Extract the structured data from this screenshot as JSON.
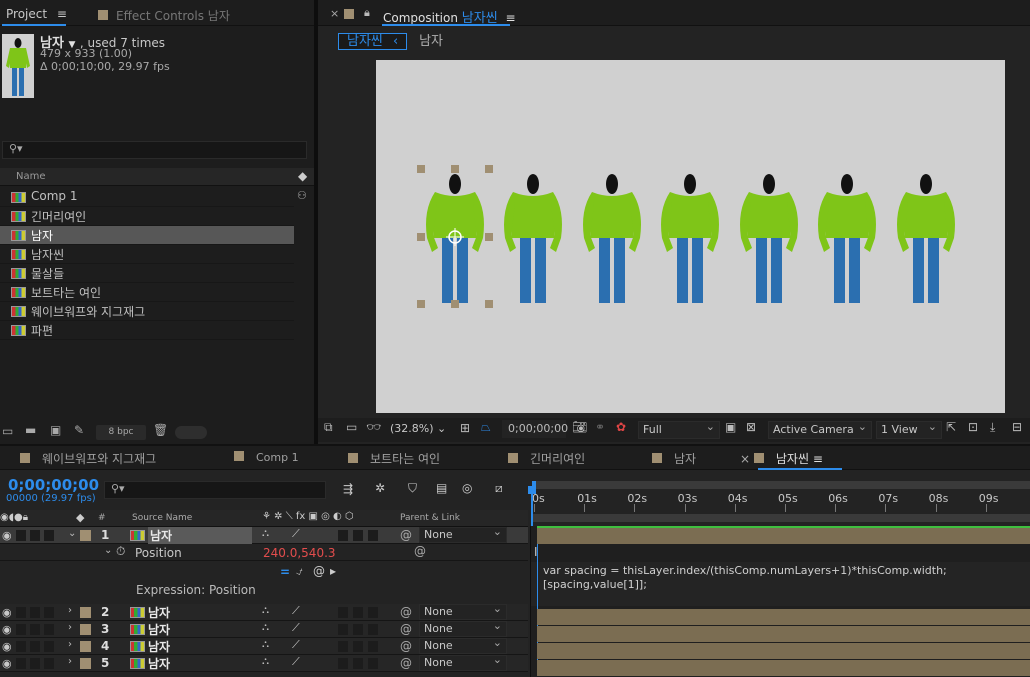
{
  "project_panel": {
    "tab_label": "Project",
    "effect_controls_label": "Effect Controls 남자",
    "footage_name": "남자",
    "used_text": ", used 7 times",
    "dimensions_text": "479 x 933 (1.00)",
    "duration_text": "Δ 0;00;10;00, 29.97 fps",
    "column_name": "Name",
    "items": [
      "Comp 1",
      "긴머리여인",
      "남자",
      "남자씬",
      "물살들",
      "보트타는 여인",
      "웨이브워프와 지그재그",
      "파편"
    ],
    "selected_index": 2,
    "bpc_label": "8 bpc"
  },
  "composition_panel": {
    "title_prefix": "Composition",
    "title_name": "남자씬",
    "breadcrumb_active": "남자씬",
    "breadcrumb_other": "남자",
    "zoom": "(32.8%)",
    "timecode": "0;00;00;00",
    "resolution": "Full",
    "camera": "Active Camera",
    "views": "1 View",
    "figure_count": 7,
    "bg_color": "#d0d0d0",
    "shirt_color": "#7fc518",
    "pants_color": "#2b6fb0",
    "head_color": "#111111"
  },
  "timeline": {
    "tabs": [
      "웨이브워프와 지그재그",
      "Comp 1",
      "보트타는 여인",
      "긴머리여인",
      "남자",
      "남자씬"
    ],
    "active_tab": "남자씬",
    "timecode": "0;00;00;00",
    "frame_info": "00000 (29.97 fps)",
    "col_source_name": "Source Name",
    "col_parent": "Parent & Link",
    "ruler_labels": [
      "0s",
      "01s",
      "02s",
      "03s",
      "04s",
      "05s",
      "06s",
      "07s",
      "08s",
      "09s"
    ],
    "layers": [
      {
        "num": "1",
        "name": "남자",
        "parent": "None"
      },
      {
        "num": "2",
        "name": "남자",
        "parent": "None"
      },
      {
        "num": "3",
        "name": "남자",
        "parent": "None"
      },
      {
        "num": "4",
        "name": "남자",
        "parent": "None"
      },
      {
        "num": "5",
        "name": "남자",
        "parent": "None"
      }
    ],
    "position_label": "Position",
    "position_value": "240.0,540.3",
    "expression_label": "Expression: Position",
    "expression_line1": "var spacing = thisLayer.index/(thisComp.numLayers+1)*thisComp.width;",
    "expression_line2": "[spacing,value[1]];"
  }
}
